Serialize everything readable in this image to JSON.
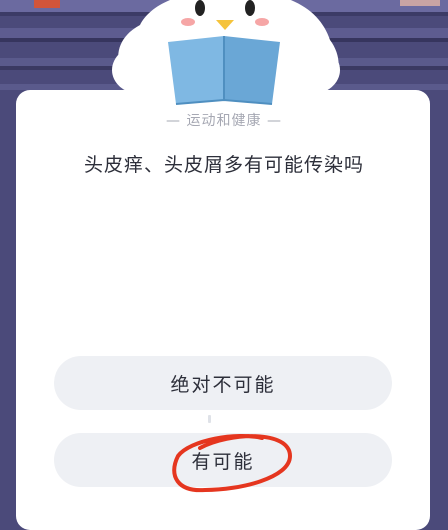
{
  "quiz": {
    "category": "— 运动和健康 —",
    "question": "头皮痒、头皮屑多有可能传染吗",
    "options": [
      {
        "label": "绝对不可能"
      },
      {
        "label": "有可能"
      }
    ]
  },
  "colors": {
    "background": "#4b4a7a",
    "card": "#ffffff",
    "option_bg": "#eef0f4",
    "annotation": "#e5361f"
  },
  "icons": {
    "mascot": "penguin-reading-book-icon",
    "annotation": "red-circle-mark"
  }
}
